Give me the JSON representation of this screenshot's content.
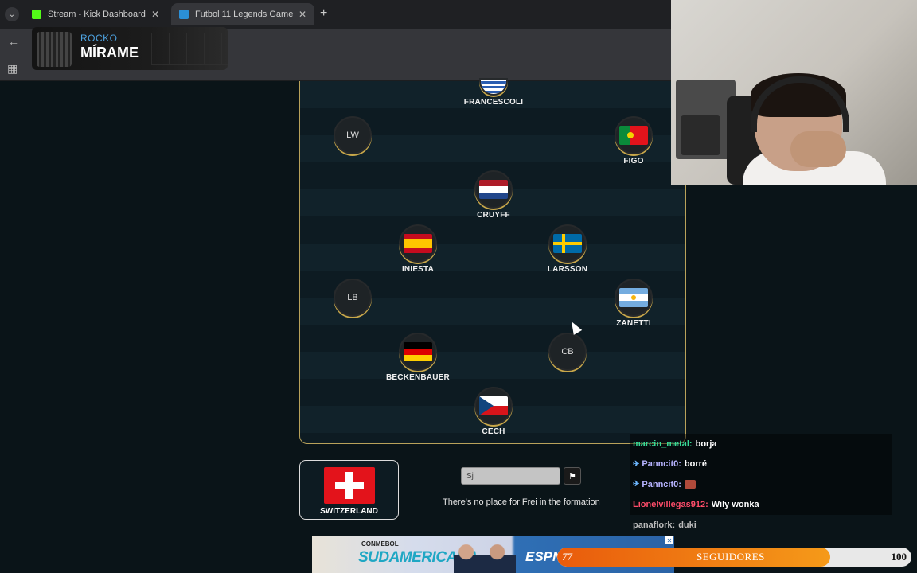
{
  "browser": {
    "tabs": [
      {
        "title": "Stream - Kick Dashboard",
        "favicon_color": "#53fc18"
      },
      {
        "title": "Futbol 11 Legends Game",
        "favicon_color": "#2b8fd6"
      }
    ]
  },
  "overlay_banner": {
    "subtitle": "ROCKO",
    "title": "MÍRAME"
  },
  "pitch": {
    "players": [
      {
        "name": "FRANCESCOLI",
        "flag": "uruguay"
      },
      {
        "name": "",
        "placeholder": "LW"
      },
      {
        "name": "FIGO",
        "flag": "portugal"
      },
      {
        "name": "CRUYFF",
        "flag": "netherlands"
      },
      {
        "name": "INIESTA",
        "flag": "spain"
      },
      {
        "name": "LARSSON",
        "flag": "sweden"
      },
      {
        "name": "",
        "placeholder": "LB"
      },
      {
        "name": "ZANETTI",
        "flag": "argentina"
      },
      {
        "name": "BECKENBAUER",
        "flag": "germany"
      },
      {
        "name": "",
        "placeholder": "CB"
      },
      {
        "name": "CECH",
        "flag": "czechia"
      }
    ]
  },
  "guess": {
    "nationality": "SWITZERLAND",
    "input_value": "Sj",
    "message": "There's no place for Frei in the formation"
  },
  "chat": [
    {
      "user": "marcin_metal:",
      "text": "borja",
      "color": "#38d996",
      "pinned": false
    },
    {
      "user": "Panncit0:",
      "text": "borré",
      "color": "#b7b4ff",
      "pinned": true
    },
    {
      "user": "Panncit0:",
      "text": "",
      "color": "#b7b4ff",
      "pinned": true,
      "emote": true
    },
    {
      "user": "Lionelvillegas912:",
      "text": "Wily wonka",
      "color": "#ff4d6a",
      "pinned": false
    },
    {
      "user": "panaflork:",
      "text": "duki",
      "color": "#bdbdbd",
      "pinned": false
    }
  ],
  "ad": {
    "brand_small": "CONMEBOL",
    "brand": "SUDAMERICANA",
    "network": "ESPN"
  },
  "followers": {
    "current": "77",
    "label": "SEGUIDORES",
    "goal": "100",
    "progress": 0.77
  }
}
